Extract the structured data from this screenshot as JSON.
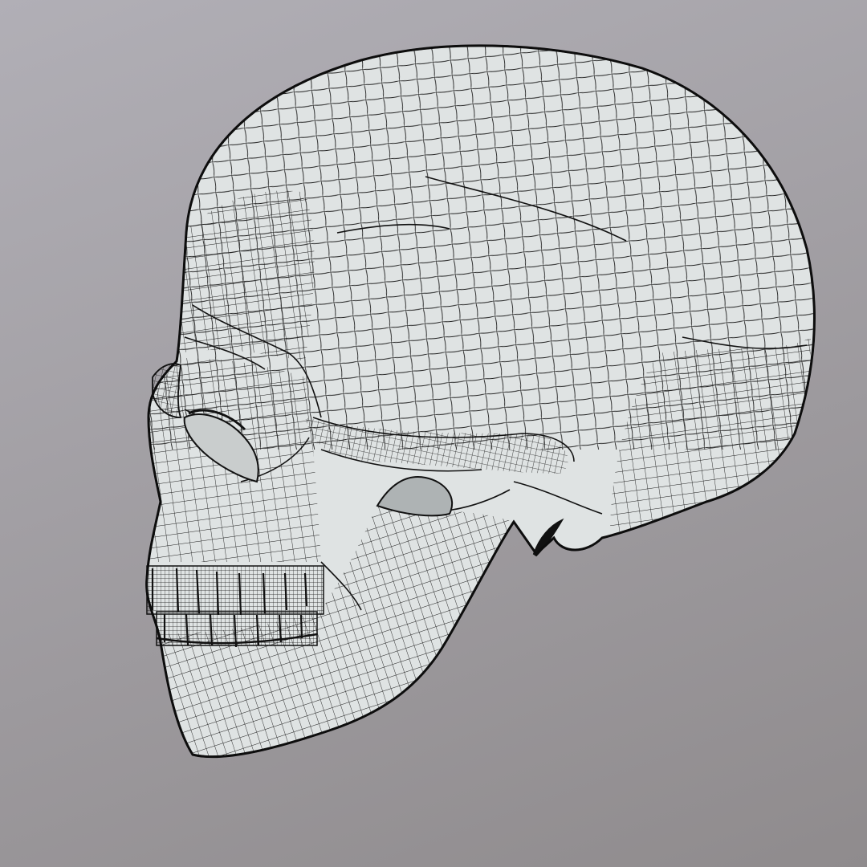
{
  "scene": {
    "subject": "wireframe-skull-mesh",
    "view": "left-three-quarter",
    "background_top": "#b1afb6",
    "background_bottom": "#8f8b8d",
    "surface_fill": "#dfe3e3",
    "wire_color": "#1a1a1a",
    "outline_color": "#111111"
  }
}
